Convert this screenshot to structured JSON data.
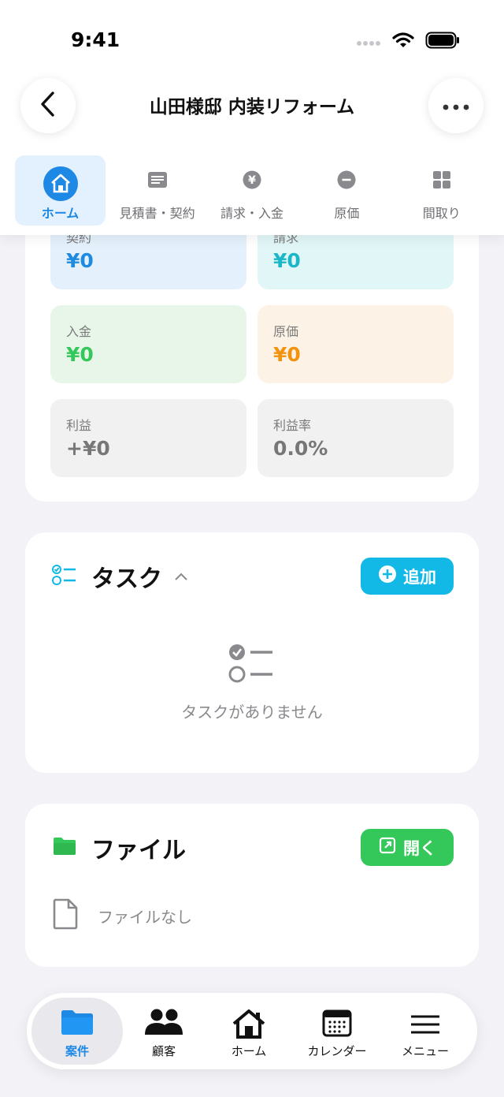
{
  "status_bar": {
    "time": "9:41"
  },
  "header": {
    "title": "山田様邸 内装リフォーム"
  },
  "tabs": [
    {
      "label": "ホーム",
      "icon": "house-icon",
      "active": true
    },
    {
      "label": "見積書・契約",
      "icon": "document-list-icon",
      "active": false
    },
    {
      "label": "請求・入金",
      "icon": "yen-coin-icon",
      "active": false
    },
    {
      "label": "原価",
      "icon": "minus-circle-icon",
      "active": false
    },
    {
      "label": "間取り",
      "icon": "grid-icon",
      "active": false
    }
  ],
  "summary": {
    "contract": {
      "label": "契約",
      "value": "¥0"
    },
    "invoice": {
      "label": "請求",
      "value": "¥0"
    },
    "payment": {
      "label": "入金",
      "value": "¥0"
    },
    "cost": {
      "label": "原価",
      "value": "¥0"
    },
    "profit": {
      "label": "利益",
      "value": "+¥0"
    },
    "profit_rate": {
      "label": "利益率",
      "value": "0.0%"
    }
  },
  "tasks": {
    "title": "タスク",
    "add_label": "追加",
    "empty_text": "タスクがありません"
  },
  "files": {
    "title": "ファイル",
    "open_label": "開く",
    "empty_text": "ファイルなし"
  },
  "bottom_nav": [
    {
      "label": "案件",
      "icon": "folder-icon",
      "active": true
    },
    {
      "label": "顧客",
      "icon": "people-icon",
      "active": false
    },
    {
      "label": "ホーム",
      "icon": "house-icon",
      "active": false
    },
    {
      "label": "カレンダー",
      "icon": "calendar-icon",
      "active": false
    },
    {
      "label": "メニュー",
      "icon": "menu-icon",
      "active": false
    }
  ],
  "colors": {
    "accent_blue": "#1e88e5",
    "cyan": "#13b9e6",
    "green": "#34c759",
    "orange": "#f3920f"
  }
}
